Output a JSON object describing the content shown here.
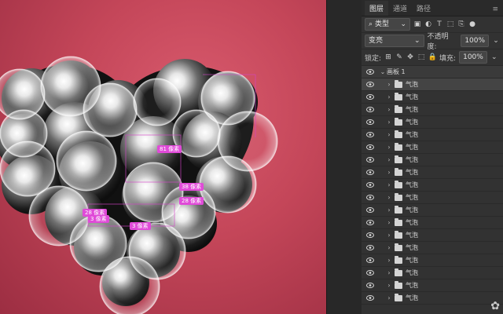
{
  "panel": {
    "tabs": [
      "图层",
      "通道",
      "路径"
    ],
    "filter_label": "类型",
    "blend_mode": "变亮",
    "opacity_label": "不透明度:",
    "opacity_value": "100%",
    "lock_label": "锁定:",
    "fill_label": "填充:",
    "fill_value": "100%",
    "artboard_name": "画板 1",
    "layers": [
      "气泡",
      "气泡",
      "气泡",
      "气泡",
      "气泡",
      "气泡",
      "气泡",
      "气泡",
      "气泡",
      "气泡",
      "气泡",
      "气泡",
      "气泡",
      "气泡",
      "气泡",
      "气泡",
      "气泡",
      "气泡"
    ]
  },
  "canvas": {
    "guides": [
      "81 像素",
      "38 像素",
      "28 像素",
      "28 像素",
      "3 像素",
      "3 像素"
    ]
  },
  "colors": {
    "accent": "#e04ad8",
    "canvas_bg": "#c44659",
    "panel_bg": "#323232"
  }
}
